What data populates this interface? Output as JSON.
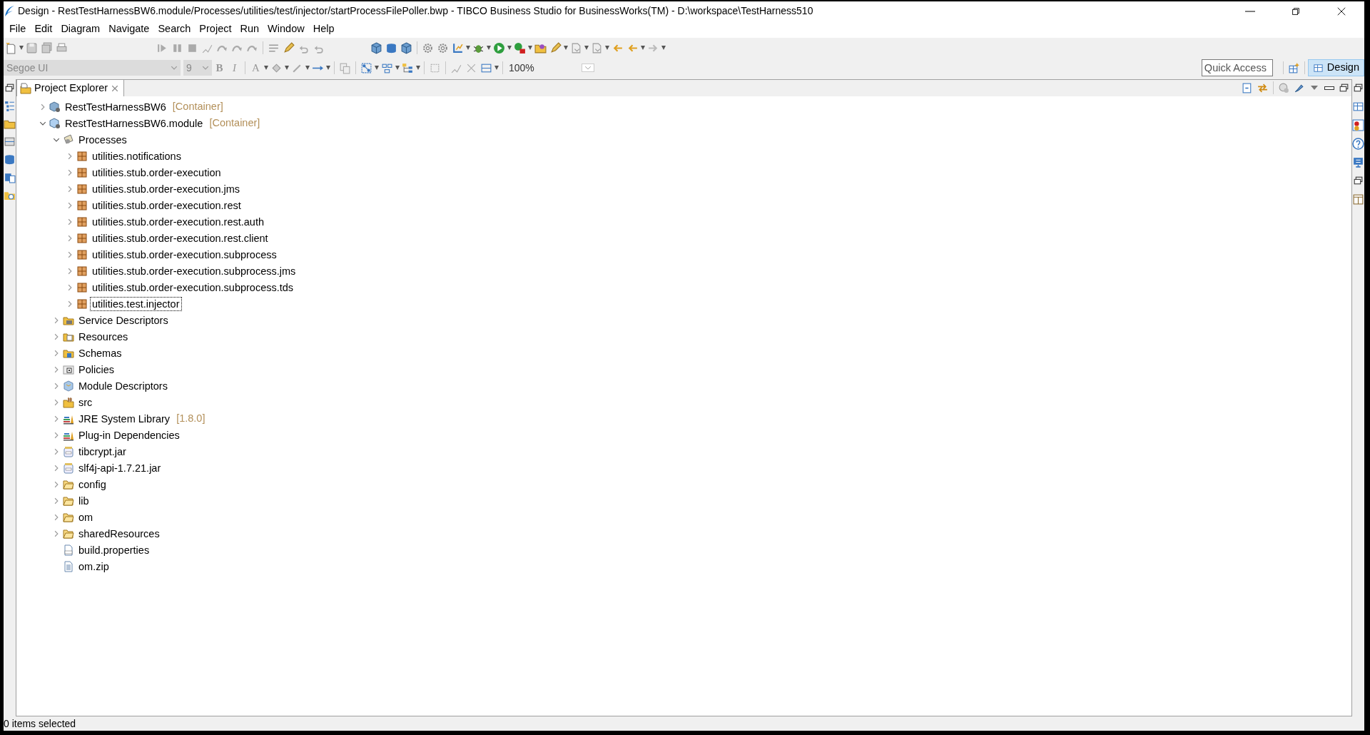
{
  "window": {
    "title": "Design - RestTestHarnessBW6.module/Processes/utilities/test/injector/startProcessFilePoller.bwp - TIBCO Business Studio for BusinessWorks(TM) - D:\\workspace\\TestHarness510"
  },
  "menu": [
    "File",
    "Edit",
    "Diagram",
    "Navigate",
    "Search",
    "Project",
    "Run",
    "Window",
    "Help"
  ],
  "format_toolbar": {
    "font": "Segoe UI",
    "size": "9",
    "zoom": "100%",
    "bold": "B",
    "italic": "I",
    "font_color": "A"
  },
  "quick_access": {
    "placeholder": "Quick Access"
  },
  "perspective": {
    "label": "Design",
    "selected": true
  },
  "view": {
    "title": "Project Explorer"
  },
  "tree": [
    {
      "label": "RestTestHarnessBW6",
      "suffix": "[Container]",
      "kind": "project",
      "expanded": false,
      "selected": false
    },
    {
      "label": "RestTestHarnessBW6.module",
      "suffix": "[Container]",
      "kind": "module",
      "expanded": true,
      "selected": false,
      "children": [
        {
          "label": "Processes",
          "kind": "processes",
          "expanded": true,
          "selected": false,
          "children": [
            {
              "label": "utilities.notifications",
              "kind": "package",
              "expanded": false,
              "selected": false
            },
            {
              "label": "utilities.stub.order-execution",
              "kind": "package",
              "expanded": false,
              "selected": false
            },
            {
              "label": "utilities.stub.order-execution.jms",
              "kind": "package",
              "expanded": false,
              "selected": false
            },
            {
              "label": "utilities.stub.order-execution.rest",
              "kind": "package",
              "expanded": false,
              "selected": false
            },
            {
              "label": "utilities.stub.order-execution.rest.auth",
              "kind": "package",
              "expanded": false,
              "selected": false
            },
            {
              "label": "utilities.stub.order-execution.rest.client",
              "kind": "package",
              "expanded": false,
              "selected": false
            },
            {
              "label": "utilities.stub.order-execution.subprocess",
              "kind": "package",
              "expanded": false,
              "selected": false
            },
            {
              "label": "utilities.stub.order-execution.subprocess.jms",
              "kind": "package",
              "expanded": false,
              "selected": false
            },
            {
              "label": "utilities.stub.order-execution.subprocess.tds",
              "kind": "package",
              "expanded": false,
              "selected": false
            },
            {
              "label": "utilities.test.injector",
              "kind": "package",
              "expanded": false,
              "selected": true
            }
          ]
        },
        {
          "label": "Service Descriptors",
          "kind": "service",
          "expanded": false,
          "selected": false
        },
        {
          "label": "Resources",
          "kind": "resources",
          "expanded": false,
          "selected": false
        },
        {
          "label": "Schemas",
          "kind": "schemas",
          "expanded": false,
          "selected": false
        },
        {
          "label": "Policies",
          "kind": "policies",
          "expanded": false,
          "selected": false
        },
        {
          "label": "Module Descriptors",
          "kind": "descriptors",
          "expanded": false,
          "selected": false
        },
        {
          "label": "src",
          "kind": "src",
          "expanded": false,
          "selected": false
        },
        {
          "label": "JRE System Library",
          "suffix": "[1.8.0]",
          "kind": "library",
          "expanded": false,
          "selected": false
        },
        {
          "label": "Plug-in Dependencies",
          "kind": "library",
          "expanded": false,
          "selected": false
        },
        {
          "label": "tibcrypt.jar",
          "kind": "jar",
          "expanded": false,
          "selected": false
        },
        {
          "label": "slf4j-api-1.7.21.jar",
          "kind": "jar",
          "expanded": false,
          "selected": false
        },
        {
          "label": "config",
          "kind": "folder",
          "expanded": false,
          "selected": false
        },
        {
          "label": "lib",
          "kind": "folder",
          "expanded": false,
          "selected": false
        },
        {
          "label": "om",
          "kind": "folder",
          "expanded": false,
          "selected": false
        },
        {
          "label": "sharedResources",
          "kind": "folder",
          "expanded": false,
          "selected": false
        },
        {
          "label": "build.properties",
          "kind": "properties",
          "selected": false
        },
        {
          "label": "om.zip",
          "kind": "file",
          "selected": false
        }
      ]
    }
  ],
  "status_bar": "0 items selected"
}
